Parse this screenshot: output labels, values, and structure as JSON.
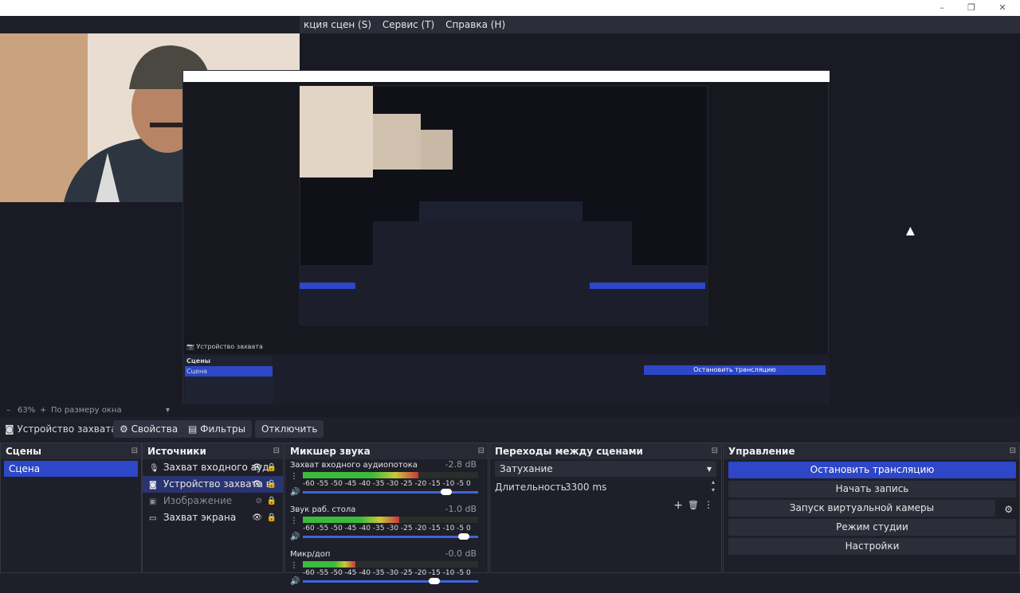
{
  "window": {
    "minimize_icon": "minimize-icon",
    "maximize_icon": "maximize-icon",
    "close_icon": "close-icon"
  },
  "menu": {
    "items": [
      "кция сцен (S)",
      "Сервис (T)",
      "Справка (H)"
    ]
  },
  "status": {
    "zoom": "63%",
    "fit_label": "По размеру окна"
  },
  "source_toolbar": {
    "source_name": "Устройство захвата",
    "properties": "Свойства",
    "filters": "Фильтры",
    "disable": "Отключить"
  },
  "scenes": {
    "title": "Сцены",
    "items": [
      "Сцена"
    ]
  },
  "sources": {
    "title": "Источники",
    "items": [
      {
        "label": "Захват входного ауд",
        "icon": "microphone-icon"
      },
      {
        "label": "Устройство захвата в",
        "icon": "camera-icon"
      },
      {
        "label": "Изображение",
        "icon": "image-icon"
      },
      {
        "label": "Захват экрана",
        "icon": "monitor-icon"
      }
    ]
  },
  "mixer": {
    "title": "Микшер звука",
    "scale": "-60 -55 -50 -45 -40 -35 -30 -25 -20 -15 -10 -5 0",
    "channels": [
      {
        "name": "Захват входного аудиопотока",
        "db": "-2.8 dB",
        "level": 0.66,
        "volume": 0.82
      },
      {
        "name": "Звук раб. стола",
        "db": "-1.0 dB",
        "level": 0.55,
        "volume": 0.92
      },
      {
        "name": "Микр/доп",
        "db": "-0.0 dB",
        "level": 0.3,
        "volume": 0.75
      }
    ]
  },
  "transitions": {
    "title": "Переходы между сценами",
    "selected": "Затухание",
    "duration_label": "Длительность",
    "duration_value": "3300 ms"
  },
  "controls": {
    "title": "Управление",
    "buttons": [
      "Остановить трансляцию",
      "Начать запись",
      "Запуск виртуальной камеры",
      "Режим студии",
      "Настройки"
    ]
  },
  "colors": {
    "accent": "#2d47c8",
    "background": "#1e1f29"
  }
}
